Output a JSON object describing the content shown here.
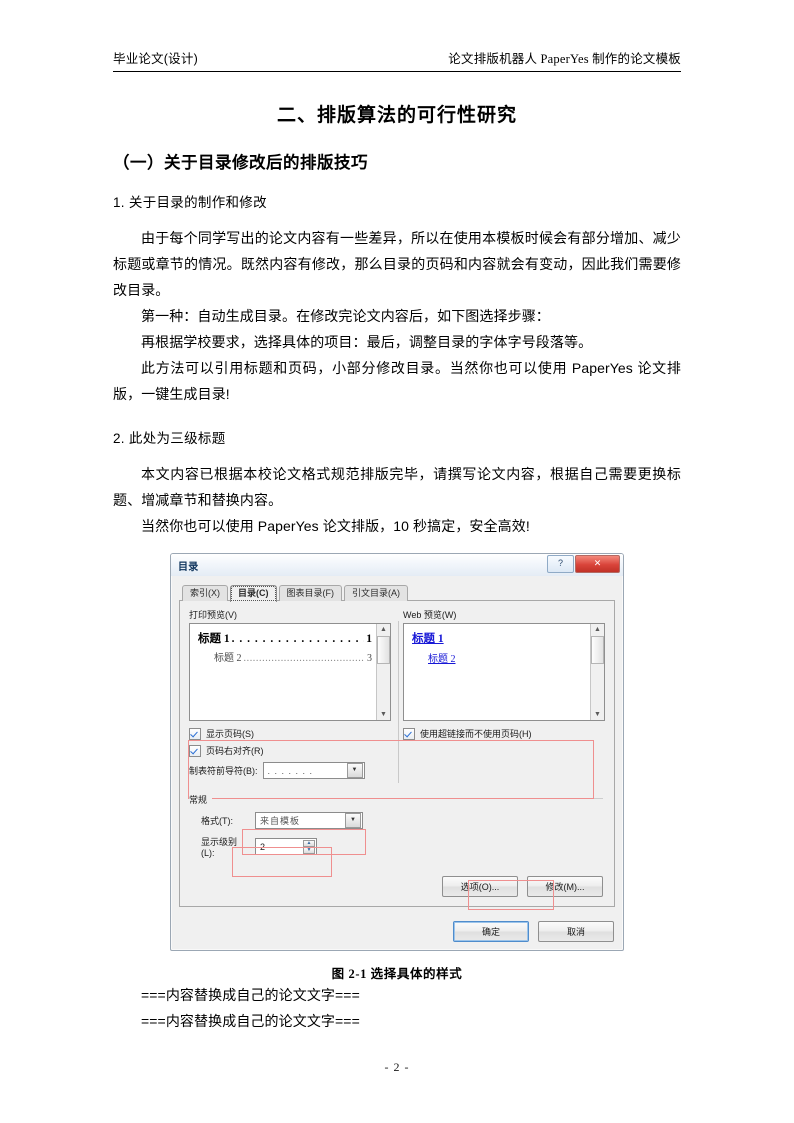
{
  "header": {
    "left": "毕业论文(设计)",
    "right": "论文排版机器人 PaperYes 制作的论文模板"
  },
  "document": {
    "title": "二、排版算法的可行性研究",
    "section_1": "（一）关于目录修改后的排版技巧",
    "heading_1_1": "1. 关于目录的制作和修改",
    "para_1": "由于每个同学写出的论文内容有一些差异，所以在使用本模板时候会有部分增加、减少标题或章节的情况。既然内容有修改，那么目录的页码和内容就会有变动，因此我们需要修改目录。",
    "para_2": "第一种：自动生成目录。在修改完论文内容后，如下图选择步骤：",
    "para_3": "再根据学校要求，选择具体的项目：最后，调整目录的字体字号段落等。",
    "para_4": "此方法可以引用标题和页码，小部分修改目录。当然你也可以使用 PaperYes 论文排版，一键生成目录!",
    "heading_1_2": "2. 此处为三级标题",
    "para_5": "本文内容已根据本校论文格式规范排版完毕，请撰写论文内容，根据自己需要更换标题、增减章节和替换内容。",
    "para_6": "当然你也可以使用 PaperYes 论文排版，10 秒搞定，安全高效!",
    "figure_caption": "图 2-1  选择具体的样式",
    "placeholder_1": "===内容替换成自己的论文文字===",
    "placeholder_2": "===内容替换成自己的论文文字===",
    "page_number": "- 2 -"
  },
  "dialog": {
    "title": "目录",
    "titlebar_buttons": {
      "help": "?",
      "close": "✕"
    },
    "tabs": [
      {
        "label": "索引(X)",
        "active": false
      },
      {
        "label": "目录(C)",
        "active": true
      },
      {
        "label": "图表目录(F)",
        "active": false
      },
      {
        "label": "引文目录(A)",
        "active": false
      }
    ],
    "print_preview": {
      "label": "打印预览(V)",
      "entries": [
        {
          "text": "标题 1",
          "page": "1",
          "level": 1
        },
        {
          "text": "标题 2",
          "page": "3",
          "level": 2
        }
      ]
    },
    "web_preview": {
      "label": "Web 预览(W)",
      "entries": [
        {
          "text": "标题 1",
          "level": 1
        },
        {
          "text": "标题 2",
          "level": 2
        }
      ]
    },
    "options": {
      "show_page_numbers": {
        "label": "显示页码(S)",
        "checked": true
      },
      "right_align": {
        "label": "页码右对齐(R)",
        "checked": true
      },
      "tab_leader": {
        "label": "制表符前导符(B):",
        "value": ". . . . . . ."
      },
      "use_hyperlinks": {
        "label": "使用超链接而不使用页码(H)",
        "checked": true
      }
    },
    "general": {
      "group_label": "常规",
      "format_label": "格式(T):",
      "format_value": "来自模板",
      "levels_label": "显示级别(L):",
      "levels_value": "2"
    },
    "buttons": {
      "options": "选项(O)...",
      "modify": "修改(M)...",
      "ok": "确定",
      "cancel": "取消"
    }
  },
  "colors": {
    "link": "#1717d6",
    "annotation": "#ef8f8f",
    "title_text": "#0d335c",
    "close_button": "#d9443a"
  }
}
